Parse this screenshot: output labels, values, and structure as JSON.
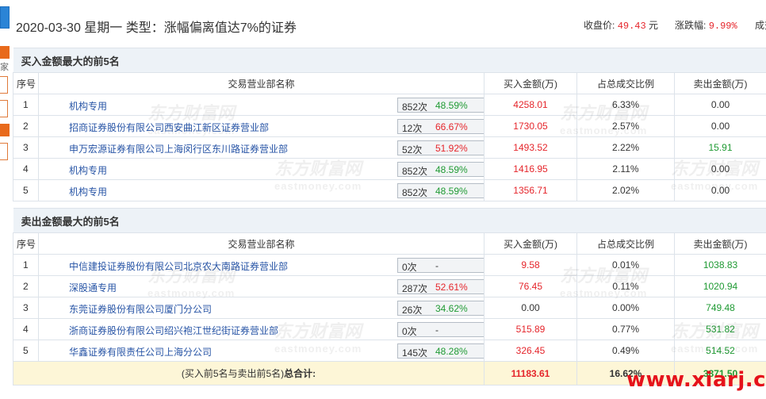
{
  "header": {
    "date": "2020-03-30",
    "weekday": "星期一",
    "type_label": "类型：",
    "type_value": "涨幅偏离值达7%的证券",
    "close_label": "收盘价:",
    "close_value": "49.43",
    "close_unit": "元",
    "chg_label": "涨跌幅:",
    "chg_value": "9.99%",
    "turnover_label": "成交"
  },
  "left_strip": {
    "text": "家"
  },
  "buy_section": {
    "title": "买入金额最大的前5名",
    "columns": [
      "序号",
      "交易营业部名称",
      "买入金额(万)",
      "占总成交比例",
      "卖出金额(万)"
    ],
    "rows": [
      {
        "seq": "1",
        "name": "机构专用",
        "count": "852次",
        "pct": "48.59%",
        "pct_color": "green",
        "icon": "question",
        "buy": "4258.01",
        "ratio": "6.33%",
        "sell": "0.00",
        "sell_color": "black"
      },
      {
        "seq": "2",
        "name": "招商证券股份有限公司西安曲江新区证券营业部",
        "count": "12次",
        "pct": "66.67%",
        "pct_color": "red",
        "icon": "arrow",
        "buy": "1730.05",
        "ratio": "2.57%",
        "sell": "0.00",
        "sell_color": "black"
      },
      {
        "seq": "3",
        "name": "申万宏源证券有限公司上海闵行区东川路证券营业部",
        "count": "52次",
        "pct": "51.92%",
        "pct_color": "red",
        "icon": "arrow",
        "buy": "1493.52",
        "ratio": "2.22%",
        "sell": "15.91",
        "sell_color": "green"
      },
      {
        "seq": "4",
        "name": "机构专用",
        "count": "852次",
        "pct": "48.59%",
        "pct_color": "green",
        "icon": "arrow",
        "buy": "1416.95",
        "ratio": "2.11%",
        "sell": "0.00",
        "sell_color": "black"
      },
      {
        "seq": "5",
        "name": "机构专用",
        "count": "852次",
        "pct": "48.59%",
        "pct_color": "green",
        "icon": "arrow",
        "buy": "1356.71",
        "ratio": "2.02%",
        "sell": "0.00",
        "sell_color": "black"
      }
    ]
  },
  "sell_section": {
    "title": "卖出金额最大的前5名",
    "columns": [
      "序号",
      "交易营业部名称",
      "买入金额(万)",
      "占总成交比例",
      "卖出金额(万)"
    ],
    "rows": [
      {
        "seq": "1",
        "name": "中信建投证券股份有限公司北京农大南路证券营业部",
        "count": "0次",
        "pct": "-",
        "pct_color": "black",
        "icon": "arrow",
        "buy": "9.58",
        "buy_color": "red",
        "ratio": "0.01%",
        "sell": "1038.83"
      },
      {
        "seq": "2",
        "name": "深股通专用",
        "count": "287次",
        "pct": "52.61%",
        "pct_color": "red",
        "icon": "arrow",
        "buy": "76.45",
        "buy_color": "red",
        "ratio": "0.11%",
        "sell": "1020.94"
      },
      {
        "seq": "3",
        "name": "东莞证券股份有限公司厦门分公司",
        "count": "26次",
        "pct": "34.62%",
        "pct_color": "green",
        "icon": "arrow",
        "buy": "0.00",
        "buy_color": "black",
        "ratio": "0.00%",
        "sell": "749.48"
      },
      {
        "seq": "4",
        "name": "浙商证券股份有限公司绍兴袍江世纪街证券营业部",
        "count": "0次",
        "pct": "-",
        "pct_color": "black",
        "icon": "arrow",
        "buy": "515.89",
        "buy_color": "red",
        "ratio": "0.77%",
        "sell": "531.82"
      },
      {
        "seq": "5",
        "name": "华鑫证券有限责任公司上海分公司",
        "count": "145次",
        "pct": "48.28%",
        "pct_color": "green",
        "icon": "arrow",
        "buy": "326.45",
        "buy_color": "red",
        "ratio": "0.49%",
        "sell": "514.52"
      }
    ]
  },
  "total": {
    "label_prefix": "(买入前5名与卖出前5名)",
    "label_bold": "总合计:",
    "buy_total": "11183.61",
    "ratio_total": "16.62%",
    "sell_total": "3871.50"
  },
  "watermarks": {
    "cn": "东方财富网",
    "en": "eastmoney.com",
    "site": "www.xiarj.com"
  },
  "colors": {
    "red": "#e5252b",
    "green": "#1f9a33",
    "link": "#2855a6",
    "header_bg": "#edf2f7",
    "total_bg": "#fdf6d7"
  }
}
